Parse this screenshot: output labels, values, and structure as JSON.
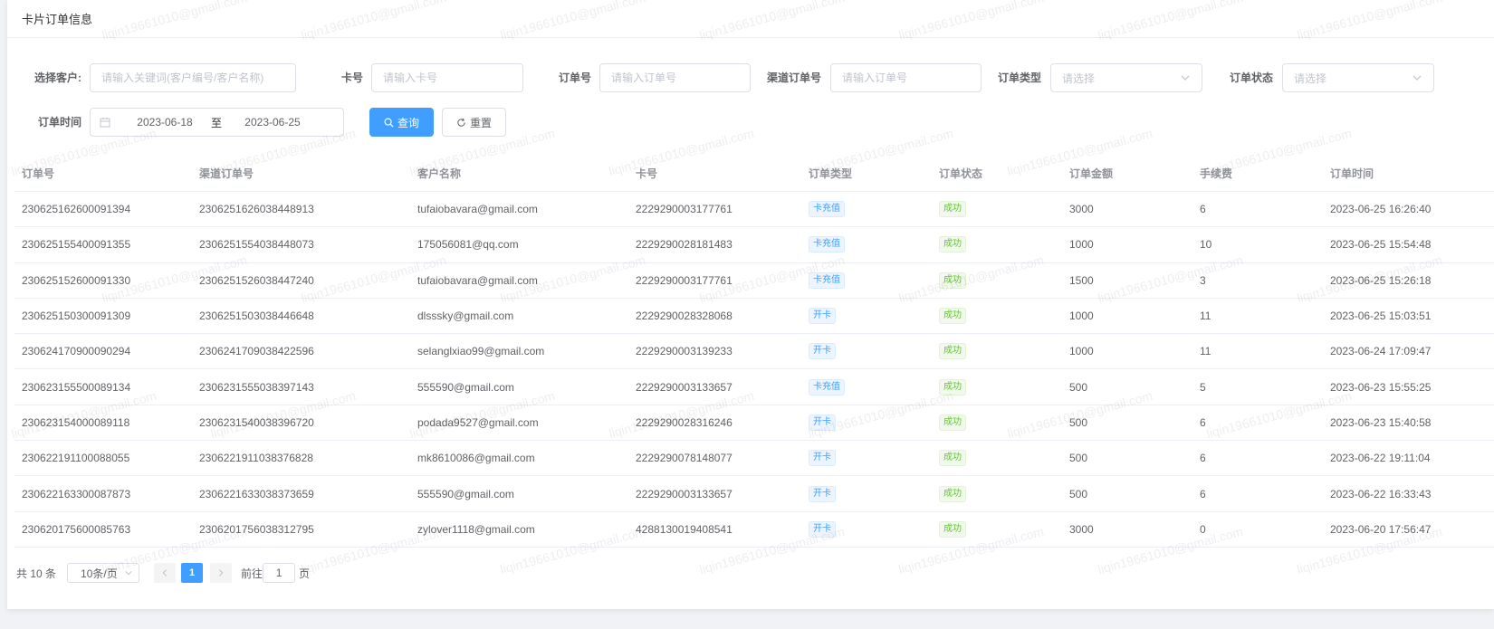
{
  "page": {
    "title": "卡片订单信息"
  },
  "filters": {
    "customer_label": "选择客户:",
    "customer_placeholder": "请输入关键词(客户编号/客户名称)",
    "card_label": "卡号",
    "card_placeholder": "请输入卡号",
    "order_label": "订单号",
    "order_placeholder": "请输入订单号",
    "channel_label": "渠道订单号",
    "channel_placeholder": "请输入订单号",
    "type_label": "订单类型",
    "type_placeholder": "请选择",
    "status_label": "订单状态",
    "status_placeholder": "请选择",
    "time_label": "订单时间",
    "date_start": "2023-06-18",
    "date_sep": "至",
    "date_end": "2023-06-25",
    "query_label": "查询",
    "reset_label": "重置"
  },
  "table": {
    "columns": [
      "订单号",
      "渠道订单号",
      "客户名称",
      "卡号",
      "订单类型",
      "订单状态",
      "订单金额",
      "手续费",
      "订单时间"
    ],
    "rows": [
      [
        "230625162600091394",
        "2306251626038448913",
        "tufaiobavara@gmail.com",
        "2229290003177761",
        "卡充值",
        "成功",
        "3000",
        "6",
        "2023-06-25 16:26:40"
      ],
      [
        "230625155400091355",
        "2306251554038448073",
        "175056081@qq.com",
        "2229290028181483",
        "卡充值",
        "成功",
        "1000",
        "10",
        "2023-06-25 15:54:48"
      ],
      [
        "230625152600091330",
        "2306251526038447240",
        "tufaiobavara@gmail.com",
        "2229290003177761",
        "卡充值",
        "成功",
        "1500",
        "3",
        "2023-06-25 15:26:18"
      ],
      [
        "230625150300091309",
        "2306251503038446648",
        "dlsssky@gmail.com",
        "2229290028328068",
        "开卡",
        "成功",
        "1000",
        "11",
        "2023-06-25 15:03:51"
      ],
      [
        "230624170900090294",
        "2306241709038422596",
        "selanglxiao99@gmail.com",
        "2229290003139233",
        "开卡",
        "成功",
        "1000",
        "11",
        "2023-06-24 17:09:47"
      ],
      [
        "230623155500089134",
        "2306231555038397143",
        "555590@gmail.com",
        "2229290003133657",
        "卡充值",
        "成功",
        "500",
        "5",
        "2023-06-23 15:55:25"
      ],
      [
        "230623154000089118",
        "2306231540038396720",
        "podada9527@gmail.com",
        "2229290028316246",
        "开卡",
        "成功",
        "500",
        "6",
        "2023-06-23 15:40:58"
      ],
      [
        "230622191100088055",
        "2306221911038376828",
        "mk8610086@gmail.com",
        "2229290078148077",
        "开卡",
        "成功",
        "500",
        "6",
        "2023-06-22 19:11:04"
      ],
      [
        "230622163300087873",
        "2306221633038373659",
        "555590@gmail.com",
        "2229290003133657",
        "开卡",
        "成功",
        "500",
        "6",
        "2023-06-22 16:33:43"
      ],
      [
        "230620175600085763",
        "2306201756038312795",
        "zylover1118@gmail.com",
        "4288130019408541",
        "开卡",
        "成功",
        "3000",
        "0",
        "2023-06-20 17:56:47"
      ]
    ]
  },
  "pagination": {
    "total": "共 10 条",
    "page_size": "10条/页",
    "current_page": "1",
    "goto_label": "前往",
    "goto_value": "1",
    "page_suffix": "页"
  },
  "watermark": {
    "text": "liqin19661010@gmail.com"
  },
  "colors": {
    "primary": "#409eff",
    "success": "#67c23a",
    "border": "#dcdfe6"
  }
}
